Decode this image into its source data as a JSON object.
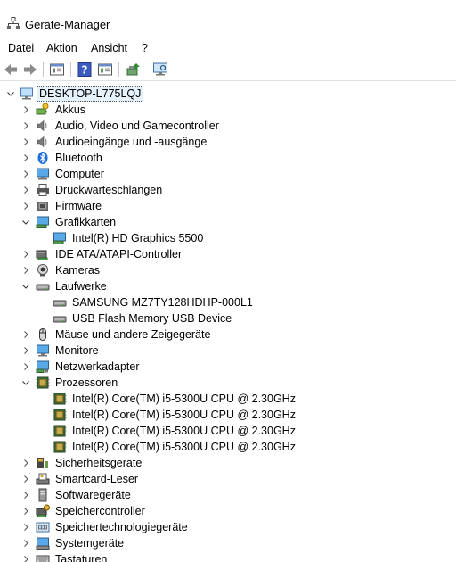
{
  "window": {
    "title": "Geräte-Manager"
  },
  "menu": [
    "Datei",
    "Aktion",
    "Ansicht",
    "?"
  ],
  "toolbar": {
    "buttons": [
      "back-icon",
      "forward-icon",
      "properties-icon",
      "help-icon",
      "view-icon",
      "update-driver-icon",
      "scan-hardware-icon"
    ]
  },
  "tree": {
    "root": "DESKTOP-L775LQJ",
    "categories": [
      {
        "label": "Akkus",
        "icon": "battery-icon",
        "expanded": false,
        "children": []
      },
      {
        "label": "Audio, Video und Gamecontroller",
        "icon": "speaker-icon",
        "expanded": false,
        "children": []
      },
      {
        "label": "Audioeingänge und -ausgänge",
        "icon": "speaker-icon",
        "expanded": false,
        "children": []
      },
      {
        "label": "Bluetooth",
        "icon": "bluetooth-icon",
        "expanded": false,
        "children": []
      },
      {
        "label": "Computer",
        "icon": "monitor-icon",
        "expanded": false,
        "children": []
      },
      {
        "label": "Druckwarteschlangen",
        "icon": "printer-icon",
        "expanded": false,
        "children": []
      },
      {
        "label": "Firmware",
        "icon": "firmware-icon",
        "expanded": false,
        "children": []
      },
      {
        "label": "Grafikkarten",
        "icon": "display-adapter-icon",
        "expanded": true,
        "children": [
          {
            "label": "Intel(R) HD Graphics 5500",
            "icon": "display-adapter-icon"
          }
        ]
      },
      {
        "label": "IDE ATA/ATAPI-Controller",
        "icon": "ide-controller-icon",
        "expanded": false,
        "children": []
      },
      {
        "label": "Kameras",
        "icon": "camera-icon",
        "expanded": false,
        "children": []
      },
      {
        "label": "Laufwerke",
        "icon": "drive-icon",
        "expanded": true,
        "children": [
          {
            "label": "SAMSUNG MZ7TY128HDHP-000L1",
            "icon": "drive-icon"
          },
          {
            "label": "USB Flash Memory USB Device",
            "icon": "drive-icon"
          }
        ]
      },
      {
        "label": "Mäuse und andere Zeigegeräte",
        "icon": "mouse-icon",
        "expanded": false,
        "children": []
      },
      {
        "label": "Monitore",
        "icon": "monitor-icon",
        "expanded": false,
        "children": []
      },
      {
        "label": "Netzwerkadapter",
        "icon": "network-adapter-icon",
        "expanded": false,
        "children": []
      },
      {
        "label": "Prozessoren",
        "icon": "processor-icon",
        "expanded": true,
        "children": [
          {
            "label": "Intel(R) Core(TM) i5-5300U CPU @ 2.30GHz",
            "icon": "processor-icon"
          },
          {
            "label": "Intel(R) Core(TM) i5-5300U CPU @ 2.30GHz",
            "icon": "processor-icon"
          },
          {
            "label": "Intel(R) Core(TM) i5-5300U CPU @ 2.30GHz",
            "icon": "processor-icon"
          },
          {
            "label": "Intel(R) Core(TM) i5-5300U CPU @ 2.30GHz",
            "icon": "processor-icon"
          }
        ]
      },
      {
        "label": "Sicherheitsgeräte",
        "icon": "security-device-icon",
        "expanded": false,
        "children": []
      },
      {
        "label": "Smartcard-Leser",
        "icon": "smartcard-reader-icon",
        "expanded": false,
        "children": []
      },
      {
        "label": "Softwaregeräte",
        "icon": "software-device-icon",
        "expanded": false,
        "children": []
      },
      {
        "label": "Speichercontroller",
        "icon": "storage-controller-icon",
        "expanded": false,
        "children": []
      },
      {
        "label": "Speichertechnologiegeräte",
        "icon": "memory-technology-icon",
        "expanded": false,
        "children": []
      },
      {
        "label": "Systemgeräte",
        "icon": "system-device-icon",
        "expanded": false,
        "children": []
      },
      {
        "label": "Tastaturen",
        "icon": "keyboard-icon",
        "expanded": false,
        "children": []
      }
    ]
  }
}
